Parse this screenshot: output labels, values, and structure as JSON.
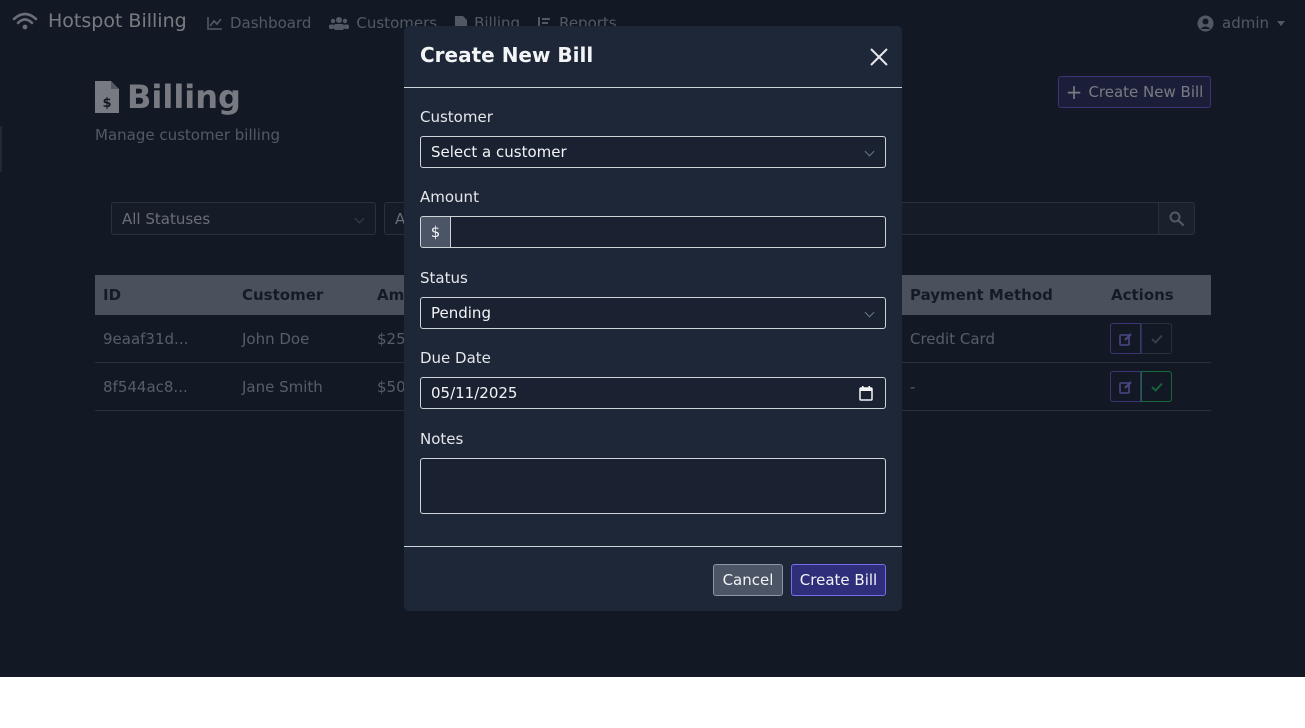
{
  "navbar": {
    "brand": "Hotspot Billing",
    "links": [
      "Dashboard",
      "Customers",
      "Billing",
      "Reports"
    ],
    "user": "admin"
  },
  "page": {
    "title": "Billing",
    "subtitle": "Manage customer billing",
    "create_button": "Create New Bill"
  },
  "filters": {
    "status_select": "All Statuses",
    "second_select_partial": "A"
  },
  "table": {
    "headers": [
      "ID",
      "Customer",
      "Amo",
      "Payment Method",
      "Actions"
    ],
    "rows": [
      {
        "id": "9eaaf31d...",
        "customer": "John Doe",
        "amount": "$25",
        "payment_method": "Credit Card"
      },
      {
        "id": "8f544ac8...",
        "customer": "Jane Smith",
        "amount": "$50",
        "payment_method": "-"
      }
    ]
  },
  "modal": {
    "title": "Create New Bill",
    "customer_label": "Customer",
    "customer_value": "Select a customer",
    "amount_label": "Amount",
    "amount_prefix": "$",
    "amount_value": "",
    "status_label": "Status",
    "status_value": "Pending",
    "due_date_label": "Due Date",
    "due_date_value": "05/11/2025",
    "notes_label": "Notes",
    "notes_value": "",
    "cancel_button": "Cancel",
    "create_button": "Create Bill"
  },
  "colors": {
    "background": "#1b2535",
    "modal": "#1e2737",
    "accent": "#6b5fd6",
    "success": "#22c55e"
  }
}
